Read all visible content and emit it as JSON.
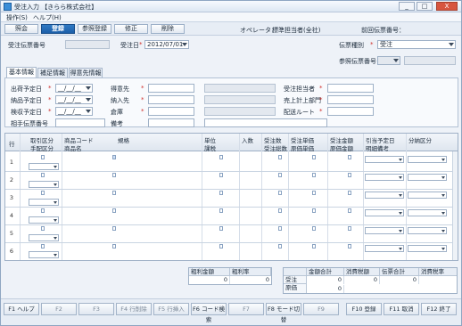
{
  "window": {
    "title": "受注入力 【きらら株式会社】",
    "controls": [
      "_",
      "□",
      "X"
    ]
  },
  "menu": {
    "items": [
      "操作(S)",
      "ヘルプ(H)"
    ]
  },
  "toolbar": {
    "buttons": [
      "照会",
      "登録",
      "参照登録",
      "修正",
      "削除"
    ],
    "active_index": 1,
    "operator_label": "オペレータ：",
    "operator_value": "標準担当者(全社)",
    "prev_slip_label": "前回伝票番号："
  },
  "header": {
    "order_no_label": "受注伝票番号",
    "order_date_label": "受注日",
    "order_date_value": "2012/07/01",
    "slip_type_label": "伝票種別",
    "slip_type_value": "受注",
    "ref_slip_label": "参照伝票番号"
  },
  "tabs": [
    "基本情報",
    "補足情報",
    "得意先情報"
  ],
  "basic": {
    "ship_date_label": "出荷予定日",
    "delivery_date_label": "納品予定日",
    "inspection_date_label": "検収予定日",
    "partner_slip_label": "相手伝票番号",
    "date_placeholder": "__/__/__",
    "customer_label": "得意先",
    "ship_to_label": "納入先",
    "warehouse_label": "倉庫",
    "remarks_label": "備考",
    "staff_label": "受注担当者",
    "dept_label": "売上計上部門",
    "route_label": "配送ルート"
  },
  "grid": {
    "headers_top": [
      "行",
      "取引区分",
      "商品コード",
      "規格",
      "単位",
      "入数",
      "受注数",
      "受注単価",
      "受注金額",
      "引当予定日",
      "分納区分"
    ],
    "headers_bottom": [
      "手配区分",
      "商品名",
      "課税",
      "受注総数",
      "原価単価",
      "原価金額",
      "明細備考"
    ],
    "rows": [
      "1",
      "2",
      "3",
      "4",
      "5",
      "6"
    ]
  },
  "totals": {
    "gross_total_label": "粗利金額",
    "gross_total_value": "0",
    "gross_rate_label": "粗利率",
    "gross_rate_value": "0",
    "amount_total_label": "金額合計",
    "tax_label": "消費税額",
    "slip_total_label": "伝票合計",
    "tax_rate_label": "消費税率",
    "order_label": "受注",
    "cost_label": "原価",
    "order_values": [
      "0",
      "0",
      "0"
    ],
    "cost_value": "0"
  },
  "fkeys": [
    {
      "label": "F1 ヘルプ",
      "enabled": true
    },
    {
      "label": "F2",
      "enabled": false
    },
    {
      "label": "F3",
      "enabled": false
    },
    {
      "label": "F4 行削除",
      "enabled": false
    },
    {
      "label": "F5 行挿入",
      "enabled": false
    },
    {
      "label": "F6 コード検索",
      "enabled": true
    },
    {
      "label": "F7",
      "enabled": false
    },
    {
      "label": "F8 モード切替",
      "enabled": true
    },
    {
      "label": "F9",
      "enabled": false
    },
    {
      "label": "F10 登録",
      "enabled": true
    },
    {
      "label": "F11 取消",
      "enabled": true
    },
    {
      "label": "F12 終了",
      "enabled": true
    }
  ],
  "colors": {
    "accent": "#1c5ea8",
    "required": "#d0312d",
    "frame": "#dfe8f3"
  }
}
